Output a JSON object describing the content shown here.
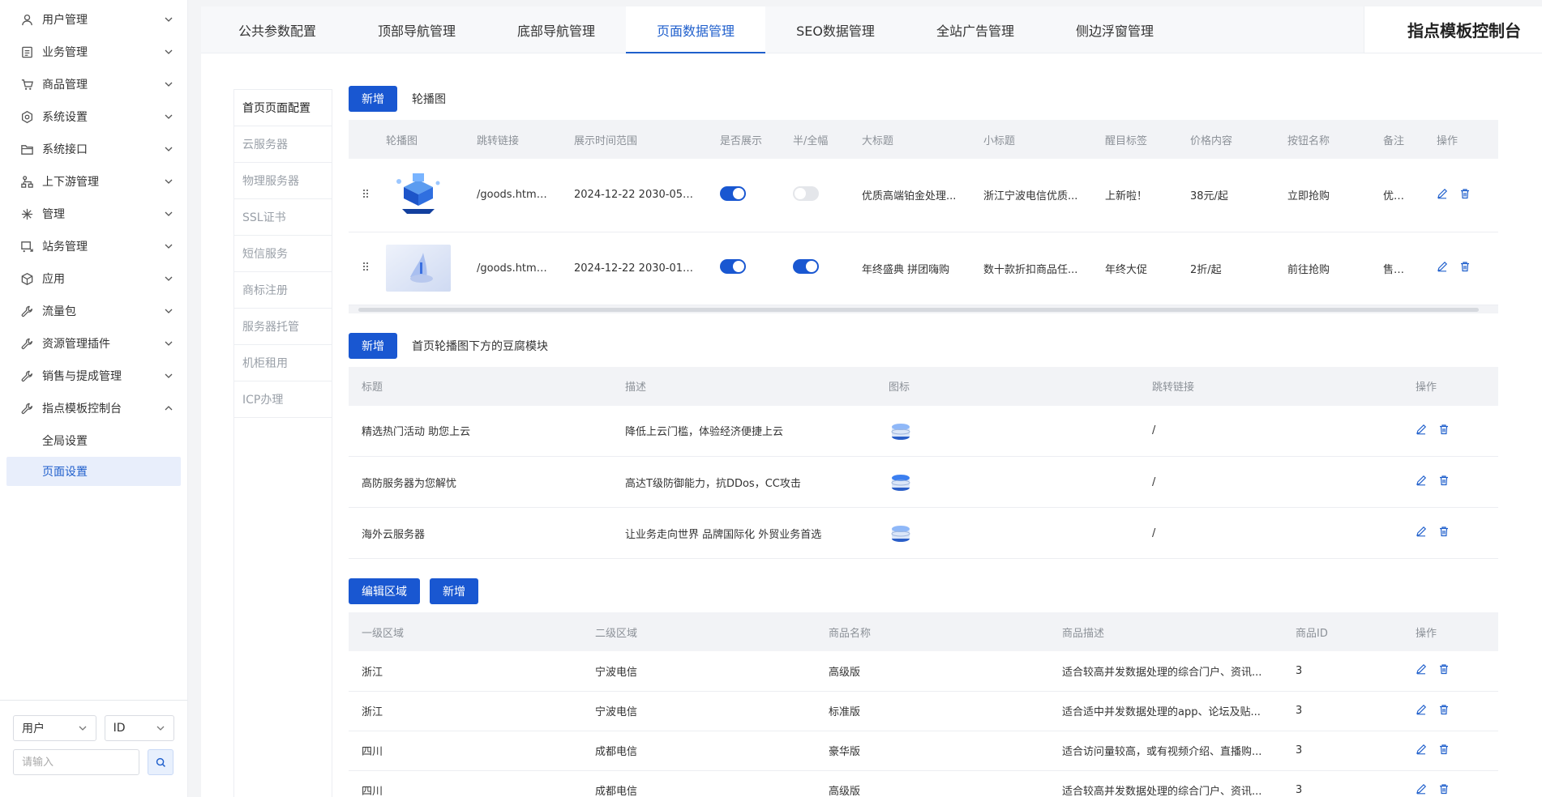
{
  "sidebar": {
    "menu": [
      {
        "label": "用户管理",
        "icon": "user-icon"
      },
      {
        "label": "业务管理",
        "icon": "document-icon"
      },
      {
        "label": "商品管理",
        "icon": "cart-icon"
      },
      {
        "label": "系统设置",
        "icon": "settings-icon"
      },
      {
        "label": "系统接口",
        "icon": "folder-icon"
      },
      {
        "label": "上下游管理",
        "icon": "hierarchy-icon"
      },
      {
        "label": "管理",
        "icon": "asterisk-icon"
      },
      {
        "label": "站务管理",
        "icon": "cart-in-icon"
      },
      {
        "label": "应用",
        "icon": "box-icon"
      },
      {
        "label": "流量包",
        "icon": "wrench-icon"
      },
      {
        "label": "资源管理插件",
        "icon": "wrench-icon"
      },
      {
        "label": "销售与提成管理",
        "icon": "wrench-icon"
      },
      {
        "label": "指点模板控制台",
        "icon": "wrench-icon"
      }
    ],
    "submenu": [
      {
        "label": "全局设置"
      },
      {
        "label": "页面设置"
      }
    ],
    "filter": {
      "select1": "用户",
      "select2": "ID",
      "search_placeholder": "请输入"
    }
  },
  "header": {
    "tabs": [
      "公共参数配置",
      "顶部导航管理",
      "底部导航管理",
      "页面数据管理",
      "SEO数据管理",
      "全站广告管理",
      "侧边浮窗管理"
    ],
    "active_tab": "页面数据管理",
    "brand": "指点模板控制台"
  },
  "subnav": [
    "首页页面配置",
    "云服务器",
    "物理服务器",
    "SSL证书",
    "短信服务",
    "商标注册",
    "服务器托管",
    "机柜租用",
    "ICP办理"
  ],
  "section1": {
    "add_label": "新增",
    "title": "轮播图",
    "columns": [
      "轮播图",
      "跳转链接",
      "展示时间范围",
      "是否展示",
      "半/全幅",
      "大标题",
      "小标题",
      "醒目标签",
      "价格内容",
      "按钮名称",
      "备注",
      "操作"
    ],
    "rows": [
      {
        "link": "/goods.html...",
        "time": "2024-12-22  2030-05-...",
        "show": true,
        "full": false,
        "title": "优质高端铂金处理...",
        "subtitle": "浙江宁波电信优质...",
        "tag": "上新啦！",
        "price": "38元/起",
        "button": "立即抢购",
        "note": "优质..."
      },
      {
        "link": "/goods.html...",
        "time": "2024-12-22  2030-01-...",
        "show": true,
        "full": true,
        "title": "年终盛典 拼团嗨购",
        "subtitle": "数十款折扣商品任...",
        "tag": "年终大促",
        "price": "2折/起",
        "button": "前往抢购",
        "note": "售完..."
      }
    ]
  },
  "section2": {
    "add_label": "新增",
    "title": "首页轮播图下方的豆腐模块",
    "columns": [
      "标题",
      "描述",
      "图标",
      "跳转链接",
      "操作"
    ],
    "rows": [
      {
        "title": "精选热门活动 助您上云",
        "desc": "降低上云门槛，体验经济便捷上云",
        "link": "/"
      },
      {
        "title": "高防服务器为您解忧",
        "desc": "高达T级防御能力，抗DDos，CC攻击",
        "link": "/"
      },
      {
        "title": "海外云服务器",
        "desc": "让业务走向世界 品牌国际化 外贸业务首选",
        "link": "/"
      }
    ]
  },
  "section3": {
    "edit_label": "编辑区域",
    "add_label": "新增",
    "columns": [
      "一级区域",
      "二级区域",
      "商品名称",
      "商品描述",
      "商品ID",
      "操作"
    ],
    "rows": [
      {
        "region1": "浙江",
        "region2": "宁波电信",
        "name": "高级版",
        "desc": "适合较高并发数据处理的综合门户、资讯...",
        "id": "3"
      },
      {
        "region1": "浙江",
        "region2": "宁波电信",
        "name": "标准版",
        "desc": "适合适中并发数据处理的app、论坛及贴...",
        "id": "3"
      },
      {
        "region1": "四川",
        "region2": "成都电信",
        "name": "豪华版",
        "desc": "适合访问量较高，或有视频介绍、直播购...",
        "id": "3"
      },
      {
        "region1": "四川",
        "region2": "成都电信",
        "name": "高级版",
        "desc": "适合较高并发数据处理的综合门户、资讯...",
        "id": "3"
      }
    ]
  },
  "colors": {
    "accent": "#1957d1",
    "active_bg": "#e8eefb"
  }
}
